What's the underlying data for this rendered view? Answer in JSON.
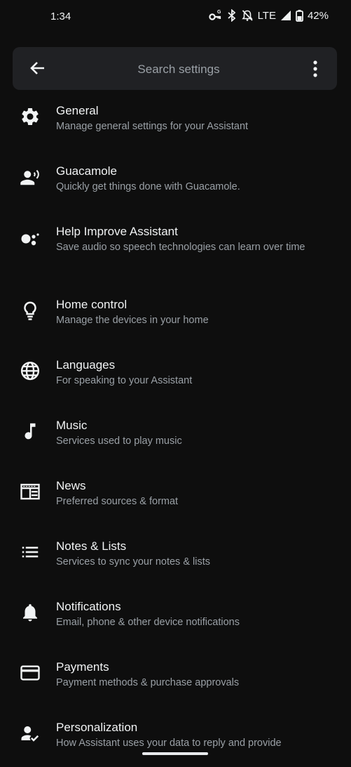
{
  "status": {
    "time": "1:34",
    "network": "LTE",
    "battery": "42%"
  },
  "search": {
    "placeholder": "Search settings"
  },
  "items": [
    {
      "title": "General",
      "subtitle": "Manage general settings for your Assistant",
      "icon": "gear-icon"
    },
    {
      "title": "Guacamole",
      "subtitle": "Quickly get things done with Guacamole.",
      "icon": "speaking-person-icon"
    },
    {
      "title": "Help Improve Assistant",
      "subtitle": "Save audio so speech technologies can learn over time",
      "icon": "assistant-dots-icon"
    },
    {
      "title": "Home control",
      "subtitle": "Manage the devices in your home",
      "icon": "lightbulb-icon"
    },
    {
      "title": "Languages",
      "subtitle": "For speaking to your Assistant",
      "icon": "globe-icon"
    },
    {
      "title": "Music",
      "subtitle": "Services used to play music",
      "icon": "music-note-icon"
    },
    {
      "title": "News",
      "subtitle": "Preferred sources & format",
      "icon": "newspaper-icon"
    },
    {
      "title": "Notes & Lists",
      "subtitle": "Services to sync your notes & lists",
      "icon": "list-icon"
    },
    {
      "title": "Notifications",
      "subtitle": "Email, phone & other device notifications",
      "icon": "bell-icon"
    },
    {
      "title": "Payments",
      "subtitle": "Payment methods & purchase approvals",
      "icon": "credit-card-icon"
    },
    {
      "title": "Personalization",
      "subtitle": "How Assistant uses your data to reply and provide",
      "icon": "person-check-icon"
    }
  ]
}
